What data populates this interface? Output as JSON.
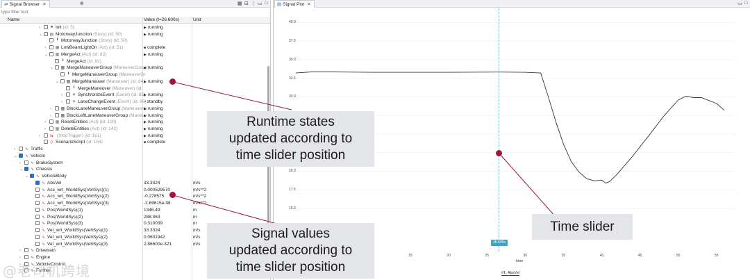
{
  "browser": {
    "tab_title": "Signal Browser",
    "filter_placeholder": "type filter text",
    "columns": {
      "name": "Name",
      "value": "Value (t=26.600s)",
      "unit": "Unit"
    }
  },
  "rows": [
    {
      "indent": 56,
      "exp": "›",
      "cb": false,
      "icon": "flag",
      "name": "Init",
      "sub": "(id: 5)",
      "val": "running",
      "tri": true,
      "unit": ""
    },
    {
      "indent": 56,
      "exp": "⌄",
      "cb": false,
      "icon": "story",
      "name": "MotorwayJunction",
      "sub": "(Story) (id: 50)",
      "val": "running",
      "tri": true,
      "unit": ""
    },
    {
      "indent": 64,
      "exp": "",
      "cb": false,
      "icon": "pin",
      "name": "MotorwayJunction",
      "sub": "(Story) (id: 50)",
      "val": "",
      "tri": false,
      "unit": ""
    },
    {
      "indent": 64,
      "exp": "›",
      "cb": false,
      "icon": "grid",
      "name": "LowBeamLightOn",
      "sub": "(Act) (id: 51)",
      "val": "complete",
      "sq": true,
      "unit": ""
    },
    {
      "indent": 64,
      "exp": "⌄",
      "cb": false,
      "icon": "grid",
      "name": "MergeAct",
      "sub": "(Act) (id: 82)",
      "val": "running",
      "tri": true,
      "unit": ""
    },
    {
      "indent": 72,
      "exp": "",
      "cb": false,
      "icon": "pin",
      "name": "MergeAct",
      "sub": "(id: 82)",
      "val": "",
      "tri": false,
      "unit": ""
    },
    {
      "indent": 72,
      "exp": "⌄",
      "cb": false,
      "icon": "group",
      "name": "MergeManeuverGroup",
      "sub": "(ManeuverGroup)",
      "val": "running",
      "tri": true,
      "unit": ""
    },
    {
      "indent": 80,
      "exp": "",
      "cb": false,
      "icon": "pin",
      "name": "MergeManeuverGroup",
      "sub": "(ManeuverGr",
      "val": "",
      "tri": false,
      "unit": ""
    },
    {
      "indent": 80,
      "exp": "⌄",
      "cb": false,
      "icon": "group",
      "name": "MergeManeuver",
      "sub": "(Maneuver) (id: 84)",
      "val": "running",
      "tri": true,
      "unit": ""
    },
    {
      "indent": 88,
      "exp": "",
      "cb": false,
      "icon": "pin",
      "name": "MergeManeuver",
      "sub": "(Maneuver) (id:",
      "val": "",
      "tri": false,
      "unit": ""
    },
    {
      "indent": 88,
      "exp": "›",
      "cb": false,
      "icon": "star",
      "name": "SynchronizeEvent",
      "sub": "(Event) (id: 85)",
      "val": "running",
      "tri": true,
      "unit": ""
    },
    {
      "indent": 88,
      "exp": "›",
      "cb": false,
      "icon": "star",
      "name": "LaneChangeEvent",
      "sub": "(Event) (id: 89)",
      "val": "standby",
      "dash": true,
      "unit": ""
    },
    {
      "indent": 72,
      "exp": "›",
      "cb": false,
      "icon": "group",
      "name": "BlockLaneManeuverGroup",
      "sub": "(ManeuverG",
      "val": "running",
      "tri": true,
      "unit": ""
    },
    {
      "indent": 72,
      "exp": "›",
      "cb": false,
      "icon": "group",
      "name": "BlockLeftLaneManeuverGroup",
      "sub": "(Maneuv",
      "val": "running",
      "tri": true,
      "unit": ""
    },
    {
      "indent": 64,
      "exp": "›",
      "cb": false,
      "icon": "grid",
      "name": "ResetEntities",
      "sub": "(Act) (id: 105)",
      "val": "running",
      "tri": true,
      "unit": ""
    },
    {
      "indent": 64,
      "exp": "›",
      "cb": false,
      "icon": "grid",
      "name": "DeleteEntities",
      "sub": "(Act) (id: 142)",
      "val": "running",
      "tri": true,
      "unit": ""
    },
    {
      "indent": 56,
      "exp": "›",
      "cb": false,
      "icon": "stop",
      "name": "",
      "sub": "(StopTrigger) (id: 161)",
      "val": "running",
      "tri": true,
      "unit": ""
    },
    {
      "indent": 56,
      "exp": "",
      "cb": false,
      "icon": "script",
      "name": "ScenarioScript",
      "sub": "(id: 164)",
      "val": "complete",
      "sq": true,
      "unit": ""
    },
    {
      "indent": 20,
      "exp": "›",
      "cb": false,
      "icon": "sig",
      "name": "Traffic",
      "sub": "",
      "val": "",
      "unit": ""
    },
    {
      "indent": 20,
      "exp": "⌄",
      "cb": true,
      "icon": "sig",
      "name": "Vehicle",
      "sub": "",
      "val": "",
      "unit": ""
    },
    {
      "indent": 28,
      "exp": "›",
      "cb": false,
      "icon": "sig",
      "name": "BrakeSystem",
      "sub": "",
      "val": "",
      "unit": ""
    },
    {
      "indent": 28,
      "exp": "⌄",
      "cb": true,
      "icon": "sig",
      "name": "Chassis",
      "sub": "",
      "val": "",
      "unit": ""
    },
    {
      "indent": 36,
      "exp": "⌄",
      "cb": true,
      "icon": "sig",
      "name": "VehicleBody",
      "sub": "",
      "val": "",
      "unit": ""
    },
    {
      "indent": 44,
      "exp": "",
      "cb": true,
      "icon": "wave",
      "name": "AbsVel",
      "sub": "",
      "val": "33.3324",
      "unit": "m/s"
    },
    {
      "indent": 44,
      "exp": "",
      "cb": false,
      "icon": "wave",
      "name": "Acc_wrt_WorldSys(VehSys)(1)",
      "sub": "",
      "val": "0.000529570",
      "unit": "m/s**2"
    },
    {
      "indent": 44,
      "exp": "",
      "cb": false,
      "icon": "wave",
      "name": "Acc_wrt_WorldSys(VehSys)(2)",
      "sub": "",
      "val": "-0.278575",
      "unit": "m/s**2"
    },
    {
      "indent": 44,
      "exp": "",
      "cb": false,
      "icon": "wave",
      "name": "Acc_wrt_WorldSys(VehSys)(3)",
      "sub": "",
      "val": "-2.69815e-08",
      "unit": "m/s**2"
    },
    {
      "indent": 44,
      "exp": "",
      "cb": false,
      "icon": "wave",
      "name": "Pos(WorldSys)(1)",
      "sub": "",
      "val": "1346.49",
      "unit": "m"
    },
    {
      "indent": 44,
      "exp": "",
      "cb": false,
      "icon": "wave",
      "name": "Pos(WorldSys)(2)",
      "sub": "",
      "val": "288.363",
      "unit": "m"
    },
    {
      "indent": 44,
      "exp": "",
      "cb": false,
      "icon": "wave",
      "name": "Pos(WorldSys)(3)",
      "sub": "",
      "val": "0.310039",
      "unit": "m"
    },
    {
      "indent": 44,
      "exp": "",
      "cb": false,
      "icon": "wave",
      "name": "Vel_wrt_WorldSys(VehSys)(1)",
      "sub": "",
      "val": "33.3324",
      "unit": "m/s"
    },
    {
      "indent": 44,
      "exp": "",
      "cb": false,
      "icon": "wave",
      "name": "Vel_wrt_WorldSys(VehSys)(2)",
      "sub": "",
      "val": "0.0601942",
      "unit": "m/s"
    },
    {
      "indent": 44,
      "exp": "",
      "cb": false,
      "icon": "wave",
      "name": "Vel_wrt_WorldSys(VehSys)(3)",
      "sub": "",
      "val": "2.86600e-321",
      "unit": "m/s"
    },
    {
      "indent": 28,
      "exp": "›",
      "cb": false,
      "icon": "sig",
      "name": "Drivetrain",
      "sub": "",
      "val": "",
      "unit": ""
    },
    {
      "indent": 28,
      "exp": "›",
      "cb": false,
      "icon": "sig",
      "name": "Engine",
      "sub": "",
      "val": "",
      "unit": ""
    },
    {
      "indent": 28,
      "exp": "›",
      "cb": false,
      "icon": "sig",
      "name": "VehicleControl",
      "sub": "",
      "val": "",
      "unit": ""
    },
    {
      "indent": 28,
      "exp": "›",
      "cb": false,
      "icon": "sig",
      "name": "Further",
      "sub": "",
      "val": "",
      "unit": ""
    }
  ],
  "plot": {
    "tab_title": "Signal Plot",
    "slider_time": "26.600s",
    "legend": "#1: AbsVel",
    "x_label": "time"
  },
  "chart_data": {
    "type": "line",
    "title": "",
    "xlabel": "time",
    "ylabel": "",
    "xlim": [
      0,
      57
    ],
    "ylim": [
      13.5,
      40.5
    ],
    "xticks": [
      10,
      15,
      20,
      25,
      30,
      35,
      40,
      45,
      50,
      55
    ],
    "yticks": [
      15.0,
      17.5,
      20.0,
      22.5,
      25.0,
      27.5,
      30.0,
      32.5,
      35.0,
      37.5,
      40.0
    ],
    "series": [
      {
        "name": "#1: AbsVel",
        "x": [
          0,
          2,
          5,
          10,
          15,
          20,
          26.6,
          30,
          32,
          33,
          34,
          35,
          36,
          37,
          38,
          39,
          40,
          40.5,
          41,
          42,
          44,
          46,
          48,
          50,
          51,
          52,
          53,
          54,
          55,
          56
        ],
        "y": [
          33.2,
          33.35,
          33.35,
          33.3,
          33.3,
          33.3,
          33.33,
          33.3,
          33.2,
          30.0,
          26.6,
          23.6,
          21.3,
          19.9,
          19.0,
          18.7,
          18.8,
          18.4,
          18.6,
          19.6,
          22.0,
          24.6,
          27.3,
          29.6,
          30.1,
          29.9,
          29.9,
          29.5,
          29.1,
          28.2
        ]
      }
    ]
  },
  "callouts": {
    "runtime": [
      "Runtime states",
      "updated according to",
      "time slider position"
    ],
    "signals": [
      "Signal values",
      "updated according to",
      "time slider position"
    ],
    "slider": "Time slider"
  },
  "watermark": "@老司机跨境"
}
